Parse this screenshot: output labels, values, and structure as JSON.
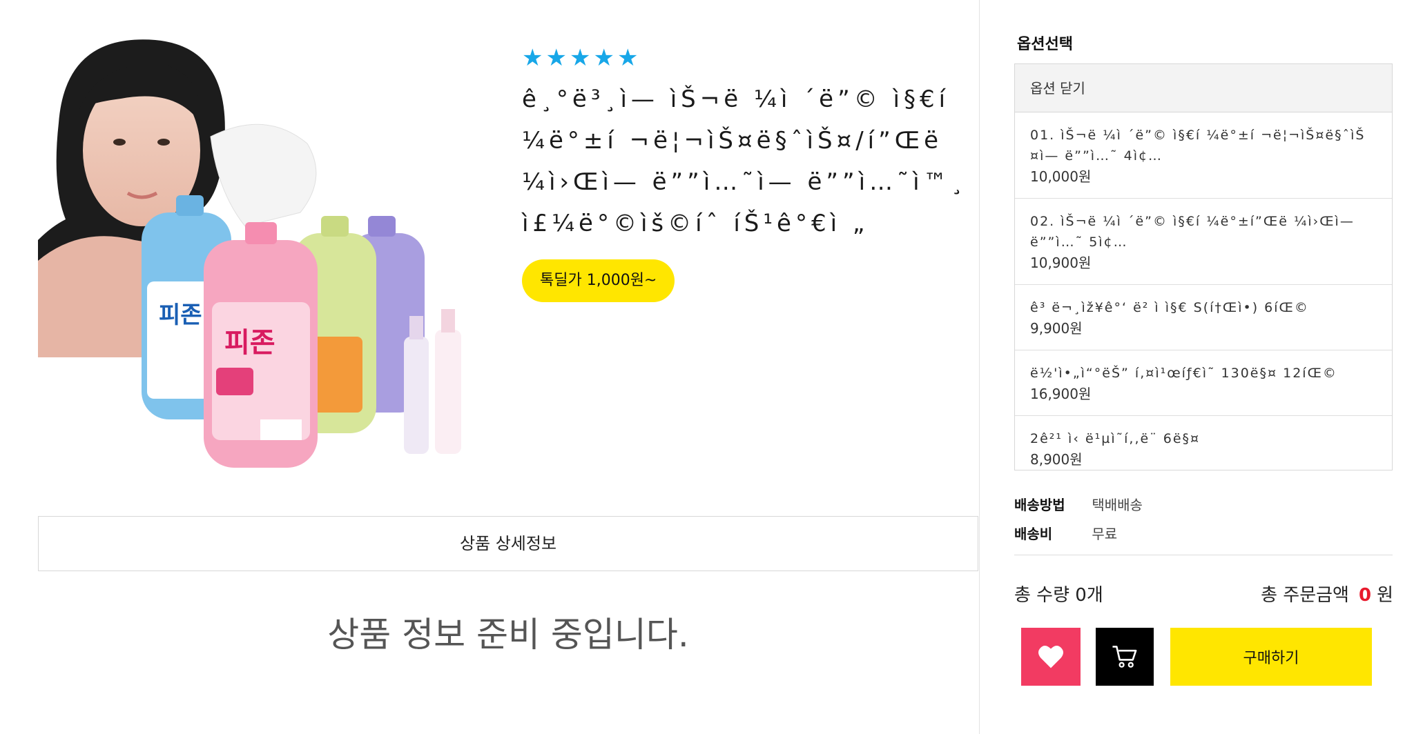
{
  "product": {
    "rating_stars": 5,
    "star_color": "#18a7e8",
    "title": "ê¸°ë³¸ì— ìŠ¬ë ¼ì ´ë”© ì§€í ¼ë°±í ¬ë¦¬ìŠ¤ë§ˆìŠ¤/í”Œë ¼ì›Œì— ë””ì…˜ì— ë””ì…˜ì™¸ ì£¼ë°©ìš©íˆ íŠ¹ê°€ì „",
    "talk_price": "톡딜가 1,000원~",
    "image_icon": "product-photo"
  },
  "detail": {
    "tab_label": "상품 상세정보",
    "empty_message": "상품 정보 준비 중입니다."
  },
  "options": {
    "title": "옵션선택",
    "close_label": "옵션 닫기",
    "items": [
      {
        "name": "01. ìŠ¬ë ¼ì ´ë”© ì§€í ¼ë°±í ¬ë¦¬ìŠ¤ë§ˆìŠ¤ì— ë””ì…˜ 4ì¢…",
        "price": "10,000원"
      },
      {
        "name": "02. ìŠ¬ë ¼ì ´ë”© ì§€í ¼ë°±í”Œë ¼ì›Œì— ë””ì…˜ 5ì¢…",
        "price": "10,900원"
      },
      {
        "name": "ê³ ë¬¸ìž¥ê°‘ ë² ì  ì§€ S(í†Œì•) 6íŒ©",
        "price": "9,900원"
      },
      {
        "name": "ë½'ì•„ì“°ëŠ” í,¤ì¹œíƒ€ì˜ 130ë§¤ 12íŒ©",
        "price": "16,900원"
      },
      {
        "name": "2ê²¹ ì‹ ë¹µì˜í,,ë¨ 6ë§¤",
        "price": "8,900원"
      }
    ]
  },
  "shipping": {
    "method_label": "배송방법",
    "method_value": "택배배송",
    "fee_label": "배송비",
    "fee_value": "무료"
  },
  "totals": {
    "qty_label": "총 수량 0개",
    "amount_label": "총 주문금액",
    "amount_value": "0",
    "amount_unit": "원",
    "amount_color": "#e8192c"
  },
  "actions": {
    "like_icon": "heart-icon",
    "cart_icon": "cart-icon",
    "buy_label": "구매하기",
    "like_color": "#f23b62",
    "buy_color": "#ffe600"
  }
}
